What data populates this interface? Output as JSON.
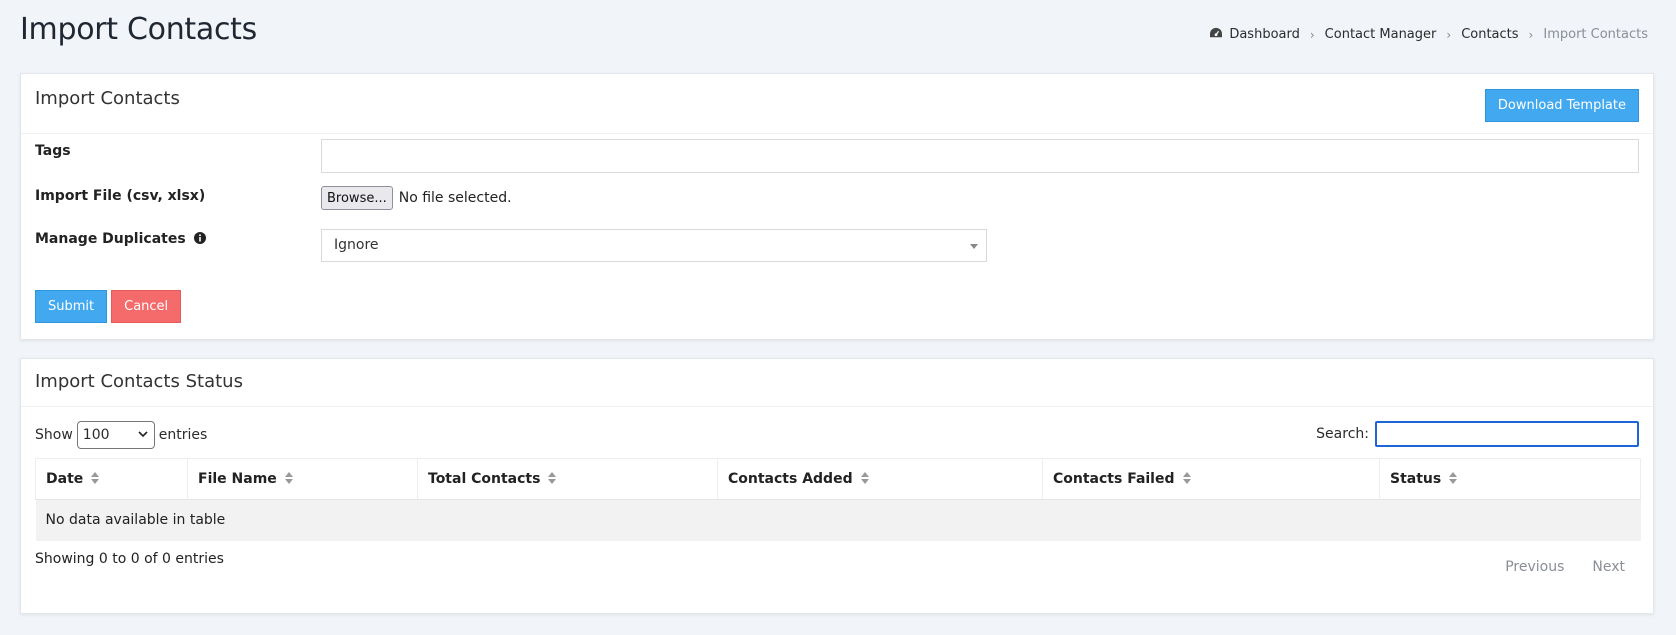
{
  "page": {
    "title": "Import Contacts"
  },
  "breadcrumb": [
    {
      "label": "Dashboard",
      "icon": "dashboard-icon"
    },
    {
      "label": "Contact Manager"
    },
    {
      "label": "Contacts"
    },
    {
      "label": "Import Contacts"
    }
  ],
  "import_form": {
    "title": "Import Contacts",
    "download_template_label": "Download Template",
    "tags_label": "Tags",
    "tags_value": "",
    "import_file_label": "Import File (csv, xlsx)",
    "browse_label": "Browse...",
    "file_status": "No file selected.",
    "manage_duplicates_label": "Manage Duplicates",
    "manage_duplicates_value": "Ignore",
    "submit_label": "Submit",
    "cancel_label": "Cancel"
  },
  "status_table": {
    "title": "Import Contacts Status",
    "show_label": "Show",
    "entries_label": "entries",
    "page_length": "100",
    "search_label": "Search:",
    "search_value": "",
    "columns": [
      "Date",
      "File Name",
      "Total Contacts",
      "Contacts Added",
      "Contacts Failed",
      "Status"
    ],
    "empty_message": "No data available in table",
    "info": "Showing 0 to 0 of 0 entries",
    "previous_label": "Previous",
    "next_label": "Next"
  },
  "colors": {
    "primary": "#42a8ef",
    "danger": "#f56a6a",
    "focus": "#1e66d6",
    "background": "#f1f4f8"
  }
}
